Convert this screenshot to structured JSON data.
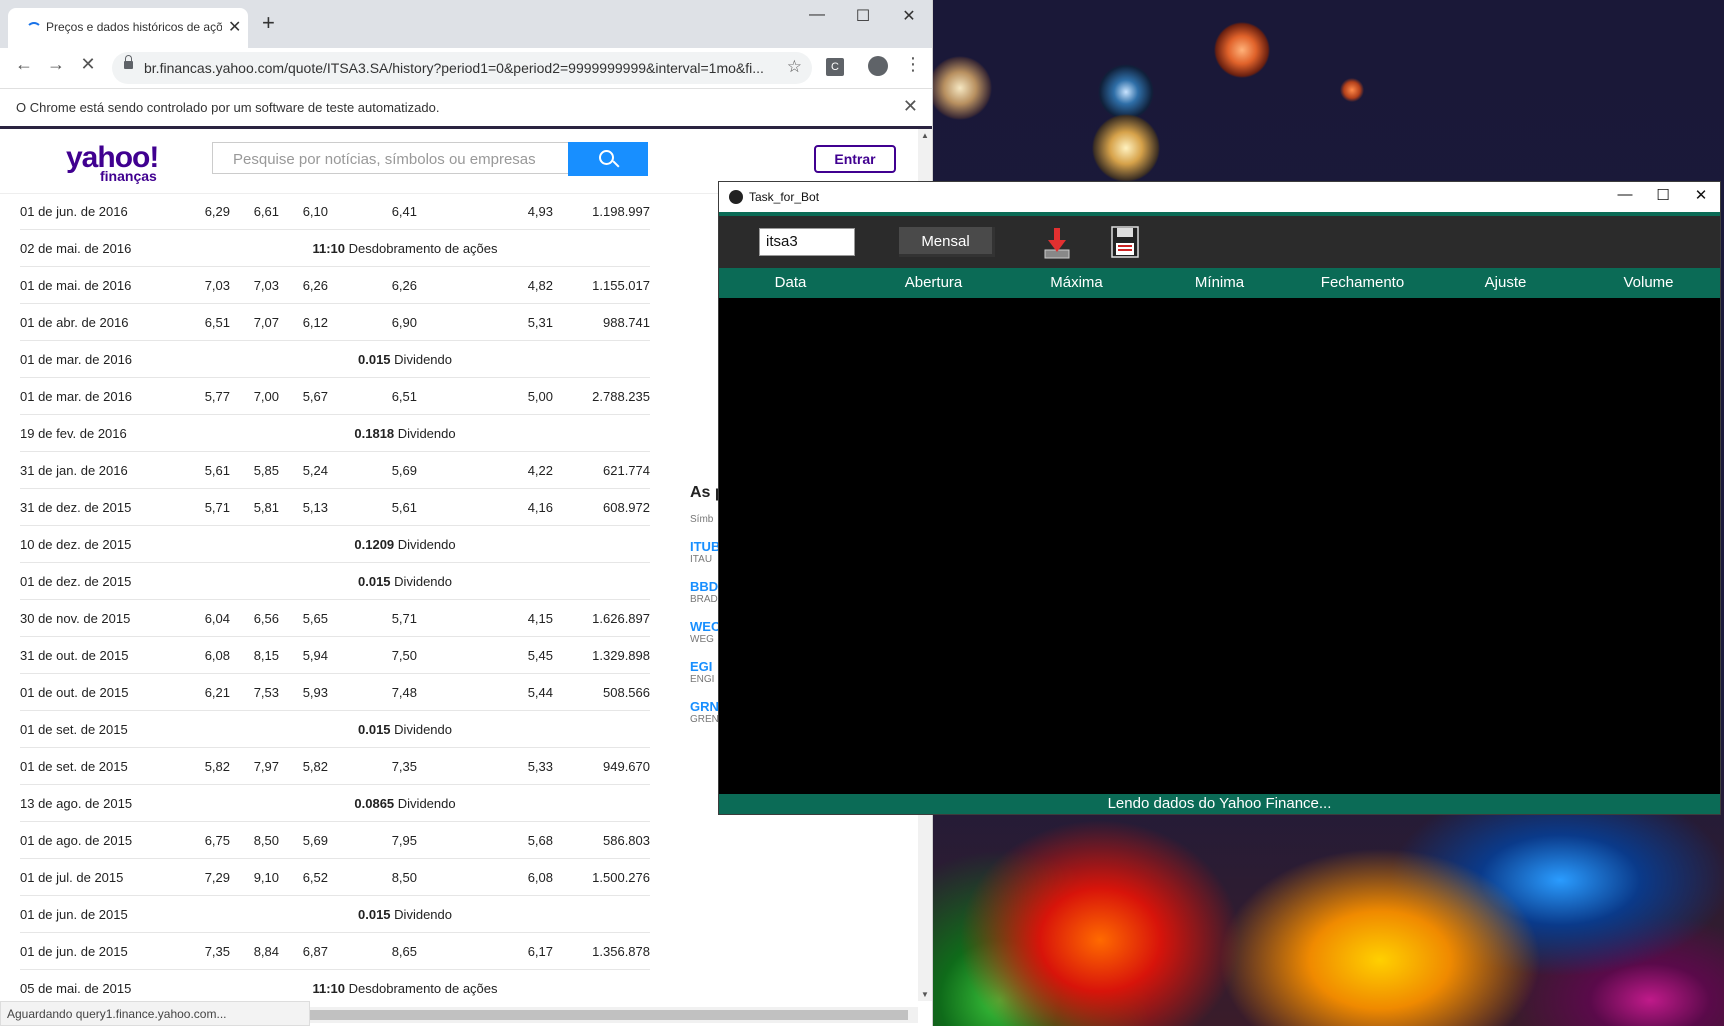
{
  "browser": {
    "tab_title": "Preços e dados históricos de açõ",
    "tab_close": "✕",
    "new_tab": "+",
    "win_min": "—",
    "win_max": "☐",
    "win_close": "✕",
    "back": "←",
    "forward": "→",
    "reload": "✕",
    "url": "br.financas.yahoo.com/quote/ITSA3.SA/history?period1=0&period2=9999999999&interval=1mo&fi...",
    "star": "☆",
    "ext_label": "C",
    "menu": "⋮",
    "infobar_text": "O Chrome está sendo controlado por um software de teste automatizado.",
    "infobar_close": "✕",
    "status_text": "Aguardando query1.finance.yahoo.com..."
  },
  "yahoo": {
    "logo_main": "yahoo!",
    "logo_sub": "finanças",
    "search_placeholder": "Pesquise por notícias, símbolos ou empresas",
    "login_label": "Entrar"
  },
  "history_rows": [
    {
      "type": "price",
      "date": "01 de jun. de 2016",
      "open": "6,29",
      "high": "6,61",
      "low": "6,10",
      "close": "6,41",
      "adj": "4,93",
      "vol": "1.198.997"
    },
    {
      "type": "event",
      "date": "02 de mai. de 2016",
      "value": "11:10",
      "label": "Desdobramento de ações"
    },
    {
      "type": "price",
      "date": "01 de mai. de 2016",
      "open": "7,03",
      "high": "7,03",
      "low": "6,26",
      "close": "6,26",
      "adj": "4,82",
      "vol": "1.155.017"
    },
    {
      "type": "price",
      "date": "01 de abr. de 2016",
      "open": "6,51",
      "high": "7,07",
      "low": "6,12",
      "close": "6,90",
      "adj": "5,31",
      "vol": "988.741"
    },
    {
      "type": "event",
      "date": "01 de mar. de 2016",
      "value": "0.015",
      "label": "Dividendo"
    },
    {
      "type": "price",
      "date": "01 de mar. de 2016",
      "open": "5,77",
      "high": "7,00",
      "low": "5,67",
      "close": "6,51",
      "adj": "5,00",
      "vol": "2.788.235"
    },
    {
      "type": "event",
      "date": "19 de fev. de 2016",
      "value": "0.1818",
      "label": "Dividendo"
    },
    {
      "type": "price",
      "date": "31 de jan. de 2016",
      "open": "5,61",
      "high": "5,85",
      "low": "5,24",
      "close": "5,69",
      "adj": "4,22",
      "vol": "621.774"
    },
    {
      "type": "price",
      "date": "31 de dez. de 2015",
      "open": "5,71",
      "high": "5,81",
      "low": "5,13",
      "close": "5,61",
      "adj": "4,16",
      "vol": "608.972"
    },
    {
      "type": "event",
      "date": "10 de dez. de 2015",
      "value": "0.1209",
      "label": "Dividendo"
    },
    {
      "type": "event",
      "date": "01 de dez. de 2015",
      "value": "0.015",
      "label": "Dividendo"
    },
    {
      "type": "price",
      "date": "30 de nov. de 2015",
      "open": "6,04",
      "high": "6,56",
      "low": "5,65",
      "close": "5,71",
      "adj": "4,15",
      "vol": "1.626.897"
    },
    {
      "type": "price",
      "date": "31 de out. de 2015",
      "open": "6,08",
      "high": "8,15",
      "low": "5,94",
      "close": "7,50",
      "adj": "5,45",
      "vol": "1.329.898"
    },
    {
      "type": "price",
      "date": "01 de out. de 2015",
      "open": "6,21",
      "high": "7,53",
      "low": "5,93",
      "close": "7,48",
      "adj": "5,44",
      "vol": "508.566"
    },
    {
      "type": "event",
      "date": "01 de set. de 2015",
      "value": "0.015",
      "label": "Dividendo"
    },
    {
      "type": "price",
      "date": "01 de set. de 2015",
      "open": "5,82",
      "high": "7,97",
      "low": "5,82",
      "close": "7,35",
      "adj": "5,33",
      "vol": "949.670"
    },
    {
      "type": "event",
      "date": "13 de ago. de 2015",
      "value": "0.0865",
      "label": "Dividendo"
    },
    {
      "type": "price",
      "date": "01 de ago. de 2015",
      "open": "6,75",
      "high": "8,50",
      "low": "5,69",
      "close": "7,95",
      "adj": "5,68",
      "vol": "586.803"
    },
    {
      "type": "price",
      "date": "01 de jul. de 2015",
      "open": "7,29",
      "high": "9,10",
      "low": "6,52",
      "close": "8,50",
      "adj": "6,08",
      "vol": "1.500.276"
    },
    {
      "type": "event",
      "date": "01 de jun. de 2015",
      "value": "0.015",
      "label": "Dividendo"
    },
    {
      "type": "price",
      "date": "01 de jun. de 2015",
      "open": "7,35",
      "high": "8,84",
      "low": "6,87",
      "close": "8,65",
      "adj": "6,17",
      "vol": "1.356.878"
    },
    {
      "type": "event",
      "date": "05 de mai. de 2015",
      "value": "11:10",
      "label": "Desdobramento de ações"
    }
  ],
  "sidebar": {
    "heading": "As p",
    "col_label": "Símb",
    "items": [
      {
        "symbol": "ITUB",
        "name": "ITAU"
      },
      {
        "symbol": "BBD",
        "name": "BRAD"
      },
      {
        "symbol": "WEC",
        "name": "WEG"
      },
      {
        "symbol": "EGI",
        "name": "ENGI"
      },
      {
        "symbol": "GRN",
        "name": "GREN"
      }
    ]
  },
  "app": {
    "title": "Task_for_Bot",
    "win_min": "—",
    "win_max": "☐",
    "win_close": "✕",
    "ticker_value": "itsa3",
    "period_button": "Mensal",
    "columns": [
      "Data",
      "Abertura",
      "Máxima",
      "Mínima",
      "Fechamento",
      "Ajuste",
      "Volume"
    ],
    "status_text": "Lendo dados do Yahoo Finance...",
    "accent_color": "#0b6b56",
    "download_icon": "download-arrow-icon",
    "save_icon": "floppy-disk-icon"
  }
}
